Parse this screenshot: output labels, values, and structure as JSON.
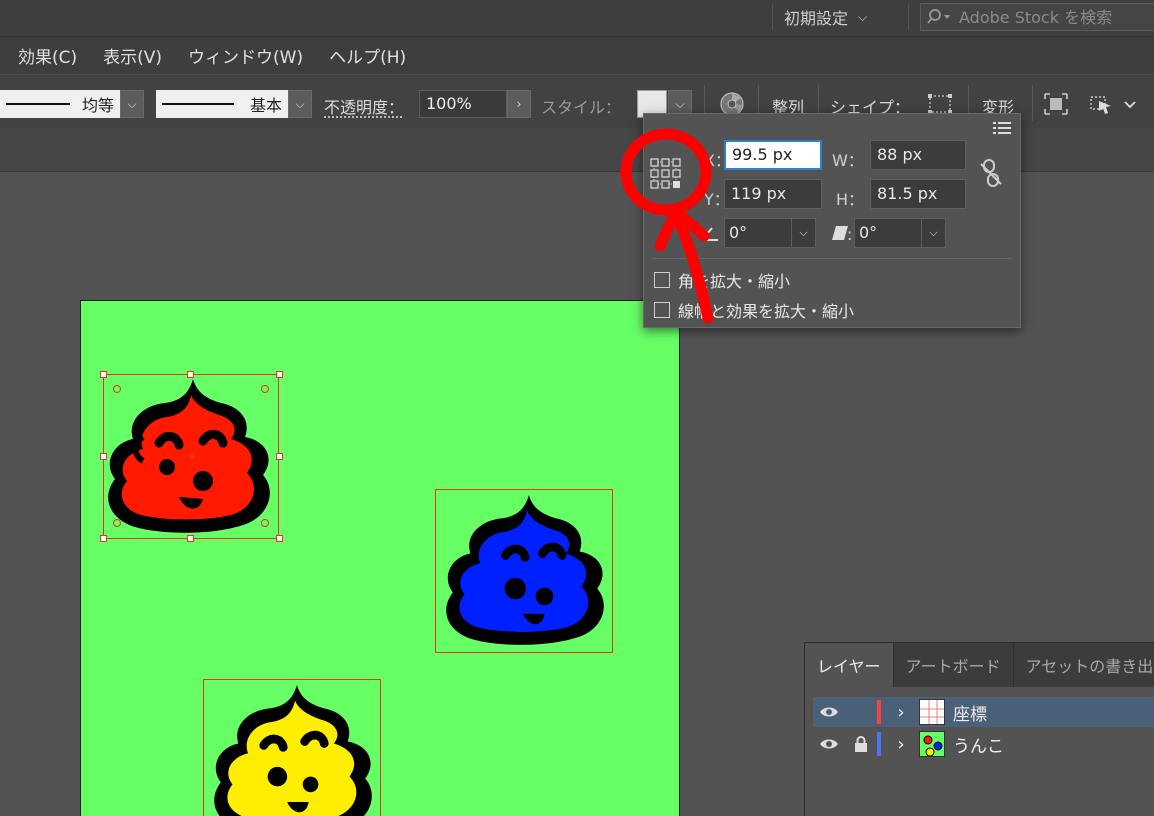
{
  "topbar": {
    "workspace_label": "初期設定",
    "search_placeholder": "Adobe Stock を検索"
  },
  "menu": {
    "items": [
      "効果(C)",
      "表示(V)",
      "ウィンドウ(W)",
      "ヘルプ(H)"
    ]
  },
  "control_bar": {
    "stroke_profile": "均等",
    "brush": "基本",
    "opacity_label": "不透明度：",
    "opacity_value": "100%",
    "style_label": "スタイル：",
    "align_label": "整列",
    "shape_label": "シェイプ：",
    "transform_label": "変形"
  },
  "transform_panel": {
    "x_label": "X：",
    "x_value": "99.5 px",
    "y_label": "Y：",
    "y_value": "119 px",
    "w_label": "W：",
    "w_value": "88 px",
    "h_label": "H：",
    "h_value": "81.5 px",
    "rotate_value": "0°",
    "shear_value": "0°",
    "scale_corners": "角を拡大・縮小",
    "scale_strokes": "線幅と効果を拡大・縮小"
  },
  "layers_panel": {
    "tabs": [
      "レイヤー",
      "アートボード",
      "アセットの書き出し"
    ],
    "layers": [
      {
        "name": "座標",
        "color": "#ff4040",
        "locked": false,
        "selected": true
      },
      {
        "name": "うんこ",
        "color": "#4f6fff",
        "locked": true,
        "selected": false
      }
    ]
  },
  "artwork": {
    "background": "#66ff66",
    "characters": [
      {
        "name": "red-poop",
        "color": "#ff1a00"
      },
      {
        "name": "blue-poop",
        "color": "#0020ff"
      },
      {
        "name": "yellow-poop",
        "color": "#ffee00"
      }
    ]
  },
  "colors": {
    "ui_dark": "#3e3e3e",
    "canvas": "#535353",
    "selection": "#e8341f",
    "annotation": "#ff0000",
    "focus": "#2f7fd6"
  }
}
